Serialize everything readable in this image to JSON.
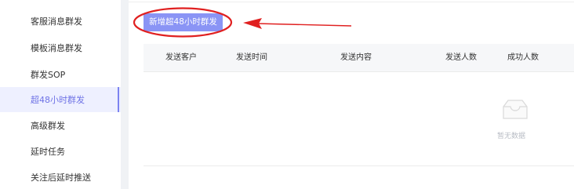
{
  "sidebar": {
    "items": [
      {
        "label": "客服消息群发"
      },
      {
        "label": "模板消息群发"
      },
      {
        "label": "群发SOP"
      },
      {
        "label": "超48小时群发",
        "active": true
      },
      {
        "label": "高级群发"
      },
      {
        "label": "延时任务"
      },
      {
        "label": "关注后延时推送"
      }
    ]
  },
  "toolbar": {
    "add_label": "新增超48小时群发"
  },
  "table": {
    "columns": [
      "发送客户",
      "发送时间",
      "发送内容",
      "发送人数",
      "成功人数"
    ],
    "rows": [],
    "empty_text": "暂无数据"
  },
  "colors": {
    "accent": "#7c83f0",
    "button": "#8a94f5",
    "annotation": "#e02020"
  },
  "icons": {
    "empty": "empty-inbox-icon"
  }
}
